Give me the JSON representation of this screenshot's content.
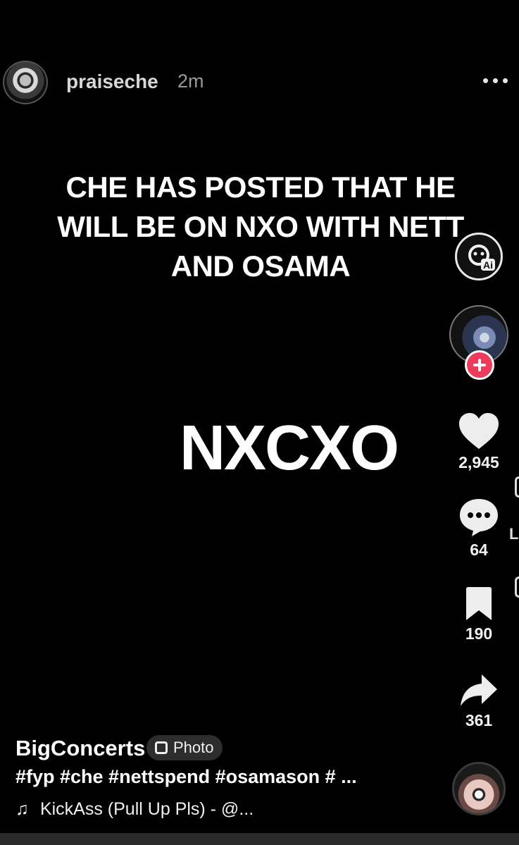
{
  "post_header": {
    "username": "praiseche",
    "time_ago": "2m",
    "more_icon": "more-horizontal-icon"
  },
  "media": {
    "headline": "CHE HAS POSTED THAT HE WILL BE ON NXO WITH NETT AND OSAMA",
    "logo_text": "NXCXO"
  },
  "actions": {
    "ai_icon": "ai-badge-icon",
    "follow_icon": "plus-icon",
    "likes": "2,945",
    "comments": "64",
    "saves": "190",
    "shares": "361"
  },
  "caption": {
    "author": "BigConcerts",
    "badge": "Photo",
    "hashtags": "#fyp #che #nettspend #osamason # ...",
    "music_note": "♫",
    "music": "KickAss (Pull Up Pls) - @..."
  },
  "edge_peek": {
    "letter": "L"
  },
  "colors": {
    "background": "#000000",
    "follow_accent": "#ee3b5b",
    "chip": "#2d2d2d"
  }
}
